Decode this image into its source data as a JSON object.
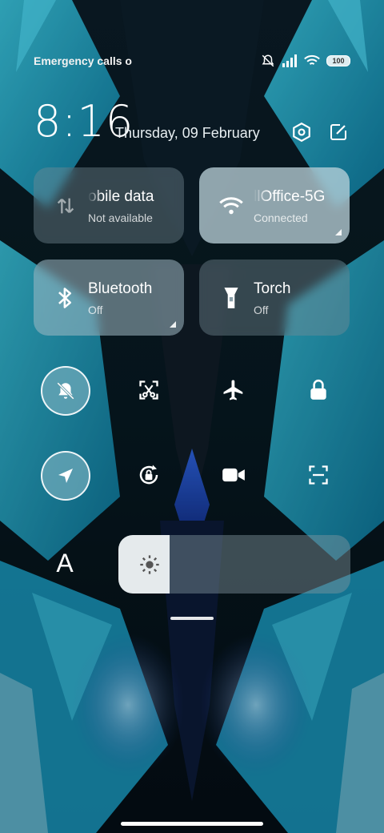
{
  "status_bar": {
    "carrier_text": "Emergency calls o",
    "battery": "100",
    "icons": [
      "mute-icon",
      "signal-icon",
      "wifi-icon",
      "battery-icon"
    ]
  },
  "header": {
    "time": "8:16",
    "date": "Thursday, 09 February",
    "settings_icon": "settings-icon",
    "edit_icon": "edit-icon"
  },
  "tiles": [
    {
      "label": "obile data",
      "sub": "Not available",
      "icon": "mobile-data-icon",
      "state": "unavailable"
    },
    {
      "label": "llOffice-5G",
      "sub": "Connected",
      "icon": "wifi-icon",
      "state": "on"
    },
    {
      "label": "Bluetooth",
      "sub": "Off",
      "icon": "bluetooth-icon",
      "state": "off"
    },
    {
      "label": "Torch",
      "sub": "Off",
      "icon": "torch-icon",
      "state": "off"
    }
  ],
  "toggles": [
    {
      "icon": "silent-icon",
      "on": true
    },
    {
      "icon": "screenshot-icon",
      "on": false
    },
    {
      "icon": "airplane-icon",
      "on": false
    },
    {
      "icon": "lock-icon",
      "on": false
    },
    {
      "icon": "location-icon",
      "on": true
    },
    {
      "icon": "rotation-lock-icon",
      "on": false
    },
    {
      "icon": "screen-record-icon",
      "on": false
    },
    {
      "icon": "scanner-icon",
      "on": false
    }
  ],
  "brightness": {
    "auto_label": "A",
    "level": 0.22,
    "icon": "sun-icon"
  },
  "colors": {
    "accent": "#2fb8d6",
    "tile": "#a0bac4",
    "background": "#06121a"
  }
}
